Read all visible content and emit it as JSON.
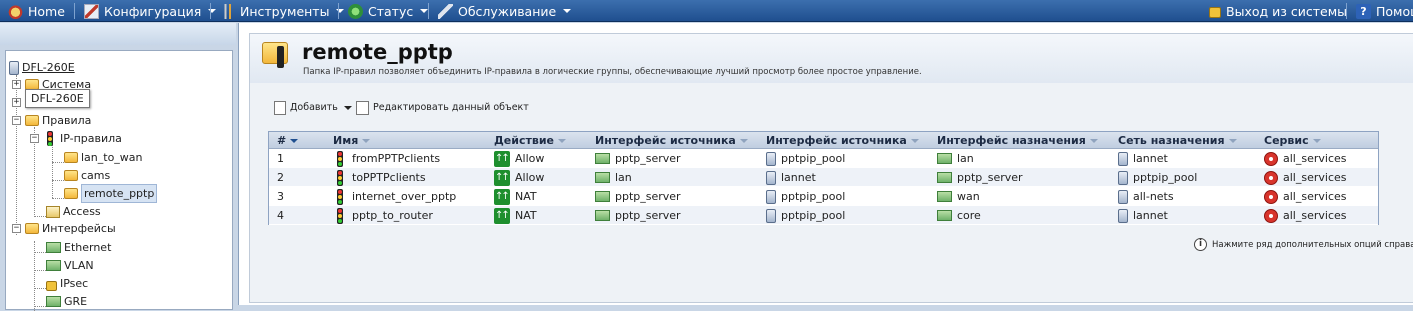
{
  "topbar": {
    "home": "Home",
    "config": "Конфигурация",
    "tools": "Инструменты",
    "status": "Статус",
    "maintenance": "Обслуживание",
    "logout": "Выход из системы",
    "help": "Помощ"
  },
  "tree": {
    "root": "DFL-260E",
    "system": "Система",
    "tooltip": "DFL-260E",
    "rules": "Правила",
    "ip_rules": "IP-правила",
    "lan_to_wan": "lan_to_wan",
    "cams": "cams",
    "remote_pptp": "remote_pptp",
    "access": "Access",
    "interfaces": "Интерфейсы",
    "ethernet": "Ethernet",
    "vlan": "VLAN",
    "ipsec": "IPsec",
    "gre": "GRE"
  },
  "page": {
    "title": "remote_pptp",
    "subtitle": "Папка IP-правил позволяет объединить IP-правила в логические группы, обеспечивающие лучший просмотр более простое управление."
  },
  "toolbar": {
    "add": "Добавить",
    "edit": "Редактировать данный объект"
  },
  "grid": {
    "headers": {
      "num": "#",
      "name": "Имя",
      "action": "Действие",
      "src_if": "Интерфейс источника",
      "src_net": "Интерфейс источника",
      "dst_if": "Интерфейс назначения",
      "dst_net": "Сеть назначения",
      "service": "Сервис"
    },
    "rows": [
      {
        "num": "1",
        "name": "fromPPTPclients",
        "action": "Allow",
        "src_if": "pptp_server",
        "src_net": "pptpip_pool",
        "dst_if": "lan",
        "dst_net": "lannet",
        "service": "all_services"
      },
      {
        "num": "2",
        "name": "toPPTPclients",
        "action": "Allow",
        "src_if": "lan",
        "src_net": "lannet",
        "dst_if": "pptp_server",
        "dst_net": "pptpip_pool",
        "service": "all_services"
      },
      {
        "num": "3",
        "name": "internet_over_pptp",
        "action": "NAT",
        "src_if": "pptp_server",
        "src_net": "pptpip_pool",
        "dst_if": "wan",
        "dst_net": "all-nets",
        "service": "all_services"
      },
      {
        "num": "4",
        "name": "pptp_to_router",
        "action": "NAT",
        "src_if": "pptp_server",
        "src_net": "pptpip_pool",
        "dst_if": "core",
        "dst_net": "lannet",
        "service": "all_services"
      }
    ]
  },
  "hint": "Нажмите ряд дополнительных опций справа."
}
